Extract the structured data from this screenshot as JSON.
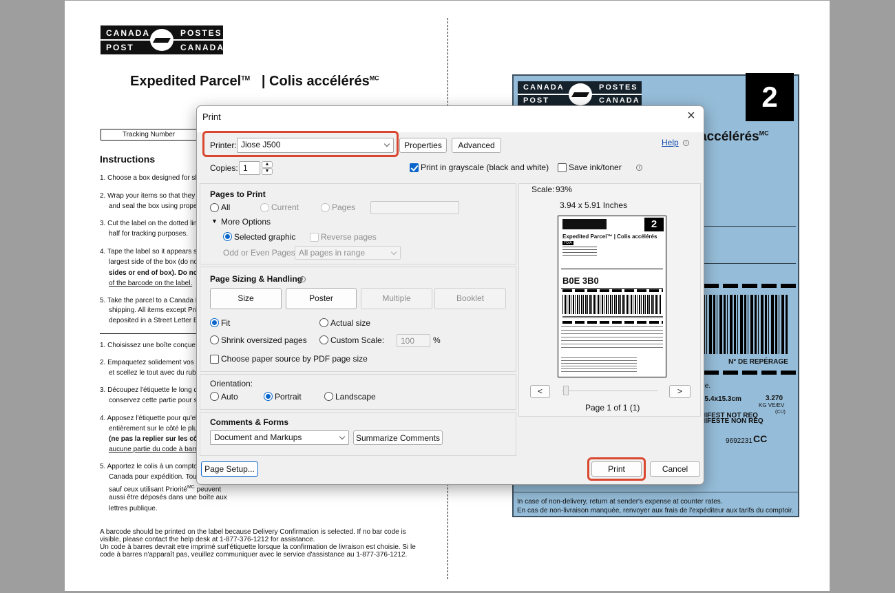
{
  "document": {
    "logo": {
      "tl": "CANADA",
      "tr": "POSTES",
      "bl": "POST",
      "br": "CANADA"
    },
    "title_en": "Expedited Parcel",
    "title_en_mark": "TM",
    "title_sep": "|",
    "title_fr": "Colis accélérés",
    "title_fr_mark": "MC",
    "tracking_label": "Tracking Number",
    "instructions_heading": "Instructions",
    "lines": [
      "1. Choose a box designed for sh",
      "2. Wrap your items so that they a",
      "and seal the box using prope",
      "3. Cut the label on the dotted lin",
      "half for tracking purposes.",
      "4. Tape the label so it appears s",
      "largest side of the box (do no",
      "sides or end of box). Do no",
      "of the barcode on the label.",
      "5. Take the parcel to a Canada P",
      "shipping. All items except Pri",
      "deposited in a Street Letter B",
      "1. Choisissez une boîte conçue",
      "2. Empaquetez solidement vos a",
      "et scellez le tout avec du ruba",
      "3. Découpez l'étiquette le long d",
      "conservez cette partie pour s",
      "4. Apposez l'étiquette pour qu'el",
      "entièrement sur le côté le plu",
      "(ne pas la replier sur les cô",
      "aucune partie du code à barr",
      "5. Apportez le colis à un compto",
      "Canada pour expédition. Tou",
      "sauf ceux utilisant Priorité",
      "aussi être déposés dans une boîte aux",
      "lettres publique."
    ],
    "priorite_mark": "MC",
    "peuvent": "peuvent",
    "footer": [
      "A barcode should be printed on the label because Delivery Confirmation is selected. If no bar code is",
      "visible, please contact the help desk at 1-877-376-1212 for assistance.",
      "Un code à barres devrait etre imprimé surl'étiquette lorsque la confirmation de livraison est choisie. Si le",
      "code à barres n'apparaît pas, veuillez communiquer avec le service d'assistance au 1-877-376-1212."
    ]
  },
  "label": {
    "number": "2",
    "title": "accélérés",
    "title_mark": "MC",
    "reperage": "N° DE REPÉRAGE",
    "ble": "ble.",
    "dims": "25.4x15.3cm",
    "weight": "3.270",
    "weight_unit": "KG VE/EV",
    "cu": "(CU)",
    "manifest_en": "NIFEST NOT REQ",
    "manifest_fr": "NIFESTE NON REQ",
    "ref": "9692231",
    "cc": "CC",
    "foot_en": "In case of non-delivery, return at sender's expense at counter rates.",
    "foot_fr": "En cas de non-livraison manquée, renvoyer aux frais de l'expéditeur aux tarifs du comptoir."
  },
  "dialog": {
    "title": "Print",
    "printer_label": "Printer:",
    "printer_value": "Jiose J500",
    "properties": "Properties",
    "advanced": "Advanced",
    "help": "Help",
    "copies_label": "Copies:",
    "copies_value": "1",
    "grayscale_label": "Print in grayscale (black and white)",
    "save_ink_label": "Save ink/toner",
    "pages_heading": "Pages to Print",
    "all": "All",
    "current": "Current",
    "pages": "Pages",
    "more_options": "More Options",
    "selected_graphic": "Selected graphic",
    "reverse_pages": "Reverse pages",
    "odd_even_label": "Odd or Even Pages:",
    "odd_even_value": "All pages in range",
    "sizing_heading": "Page Sizing & Handling",
    "size": "Size",
    "poster": "Poster",
    "multiple": "Multiple",
    "booklet": "Booklet",
    "fit": "Fit",
    "actual_size": "Actual size",
    "shrink": "Shrink oversized pages",
    "custom_scale": "Custom Scale:",
    "custom_scale_value": "100",
    "percent": "%",
    "choose_source": "Choose paper source by PDF page size",
    "orientation_heading": "Orientation:",
    "auto": "Auto",
    "portrait": "Portrait",
    "landscape": "Landscape",
    "comments_heading": "Comments & Forms",
    "comments_value": "Document and Markups",
    "summarize": "Summarize Comments",
    "scale_label": "Scale:",
    "scale_value": "93%",
    "paper_size": "3.94 x 5.91 Inches",
    "prev": "<",
    "next": ">",
    "page_of": "Page 1 of 1 (1)",
    "page_setup": "Page Setup...",
    "print": "Print",
    "cancel": "Cancel",
    "preview": {
      "number": "2",
      "title": "Expedited Parcel™ | Colis accélérés",
      "postal": "B0E 3B0",
      "to": "TO/À"
    }
  }
}
